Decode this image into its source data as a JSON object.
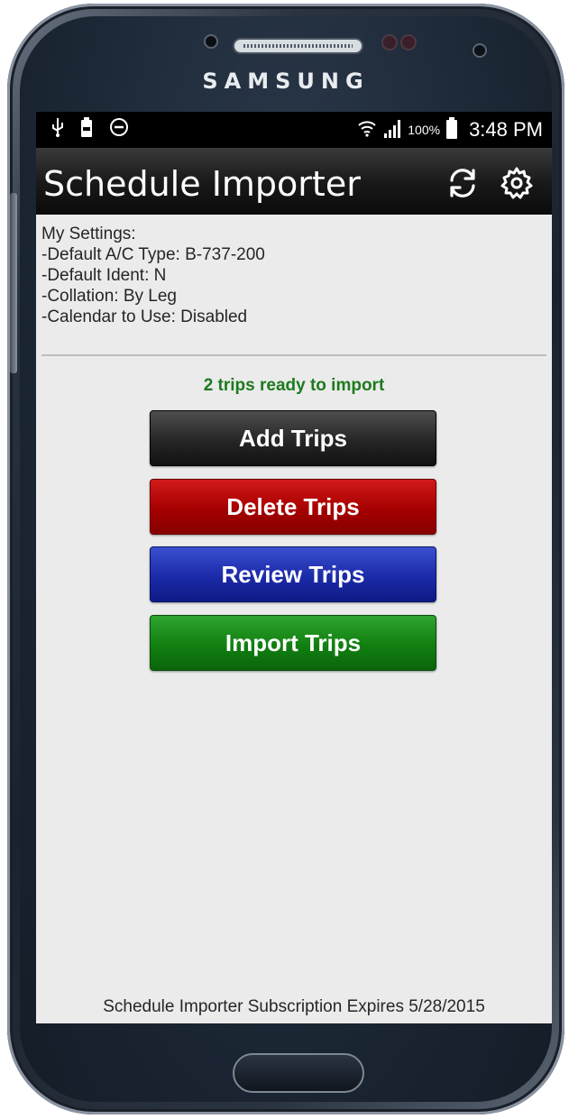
{
  "device": {
    "brand": "SAMSUNG"
  },
  "status_bar": {
    "battery_percent": "100%",
    "time": "3:48 PM",
    "left_icons": [
      "usb-icon",
      "battery-saver-icon",
      "do-not-disturb-icon"
    ],
    "right_icons": [
      "wifi-icon",
      "signal-icon",
      "battery-icon"
    ]
  },
  "app_bar": {
    "title": "Schedule Importer",
    "icons": [
      "refresh-icon",
      "settings-icon"
    ]
  },
  "settings": {
    "heading": "My Settings:",
    "lines": [
      "-Default A/C Type: B-737-200",
      "-Default Ident: N",
      "-Collation: By Leg",
      "-Calendar to Use: Disabled"
    ]
  },
  "status_message": "2 trips ready to import",
  "buttons": {
    "add": "Add Trips",
    "delete": "Delete Trips",
    "review": "Review Trips",
    "import": "Import Trips"
  },
  "footer": "Schedule Importer Subscription Expires 5/28/2015",
  "colors": {
    "status_text": "#1e7a1e",
    "add_button": "#262626",
    "delete_button": "#a60000",
    "review_button": "#1b2aa8",
    "import_button": "#117f11"
  }
}
